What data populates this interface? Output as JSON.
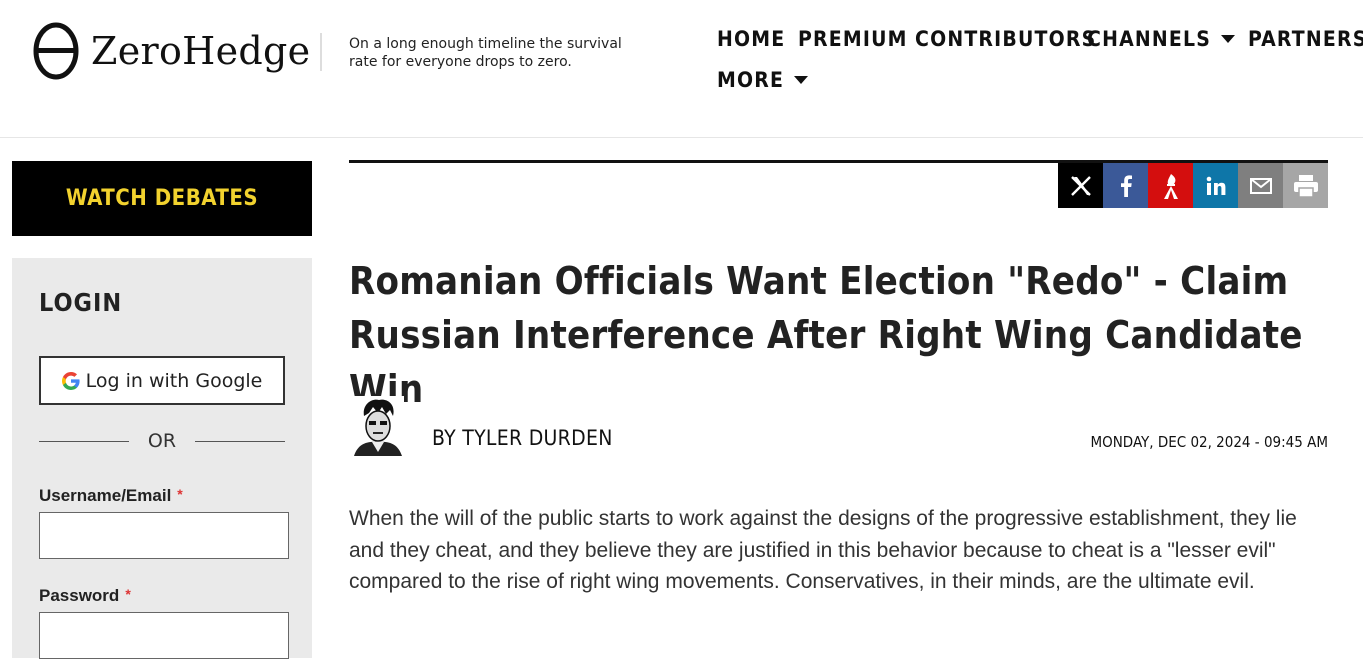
{
  "site": {
    "name": "ZeroHedge",
    "tagline": "On a long enough timeline the survival rate for everyone drops to zero."
  },
  "nav": {
    "items": [
      {
        "label": "HOME",
        "dropdown": false
      },
      {
        "label": "PREMIUM",
        "dropdown": false
      },
      {
        "label": "CONTRIBUTORS",
        "dropdown": false
      },
      {
        "label": "CHANNELS",
        "dropdown": true
      },
      {
        "label": "PARTNERS",
        "dropdown": true
      },
      {
        "label": "MORE",
        "dropdown": true
      }
    ]
  },
  "sidebar": {
    "watch_label": "WATCH DEBATES",
    "login": {
      "title": "LOGIN",
      "google_label": "Log in with Google",
      "or_text": "OR",
      "username_label": "Username/Email",
      "password_label": "Password",
      "required_mark": "*"
    }
  },
  "share": {
    "buttons": [
      {
        "icon": "x-icon",
        "color": "#000000"
      },
      {
        "icon": "facebook-icon",
        "color": "#3b5998"
      },
      {
        "icon": "gab-icon",
        "color": "#d40e0e"
      },
      {
        "icon": "linkedin-icon",
        "color": "#0e76a8"
      },
      {
        "icon": "email-icon",
        "color": "#7f7f7f"
      },
      {
        "icon": "print-icon",
        "color": "#a6a6a6"
      }
    ]
  },
  "article": {
    "headline": "Romanian Officials Want Election \"Redo\" - Claim Russian Interference After Right Wing Candidate Win",
    "byline": "BY TYLER DURDEN",
    "date": "MONDAY, DEC 02, 2024 - 09:45 AM",
    "body": "When the will of the public starts to work against the designs of the progressive establishment, they lie and they cheat, and they believe they are justified in this behavior because to cheat is a \"lesser evil\" compared to the rise of right wing movements.  Conservatives, in their minds, are the ultimate evil."
  },
  "colors": {
    "watch_bg": "#000000",
    "watch_text": "#f2d22e",
    "login_bg": "#eaeaea"
  }
}
